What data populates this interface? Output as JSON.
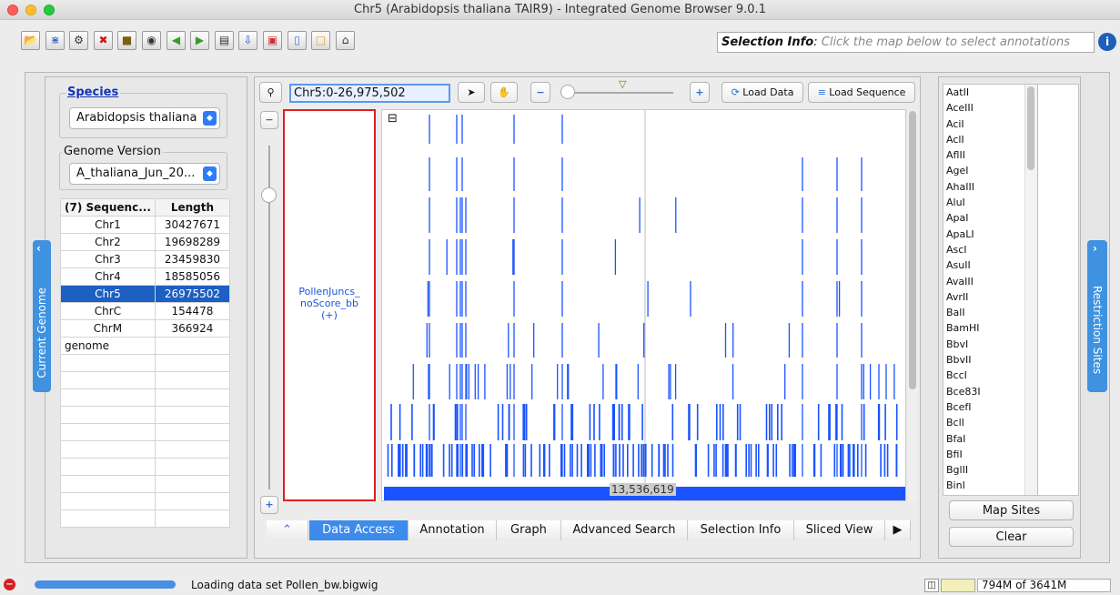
{
  "window": {
    "title": "Chr5  (Arabidopsis thaliana TAIR9) - Integrated Genome Browser 9.0.1"
  },
  "toolbar": {
    "icons": [
      "open-folder-icon",
      "dna-icon",
      "gear-icon",
      "stop-icon",
      "bookmark-icon",
      "camera-icon",
      "back-arrow-icon",
      "forward-arrow-icon",
      "film-icon",
      "export-image-icon",
      "window-icon",
      "document-icon",
      "comment-icon",
      "home-icon"
    ],
    "selection_label": "Selection Info",
    "selection_hint": "Click the map below to select annotations",
    "info_label": "i"
  },
  "left": {
    "tab_label": "Current Genome",
    "species_label": "Species",
    "species_value": "Arabidopsis thaliana",
    "genome_label": "Genome Version",
    "genome_value": "A_thaliana_Jun_20...",
    "table": {
      "headers": [
        "(7) Sequenc...",
        "Length"
      ],
      "rows": [
        [
          "Chr1",
          "30427671"
        ],
        [
          "Chr2",
          "19698289"
        ],
        [
          "Chr3",
          "23459830"
        ],
        [
          "Chr4",
          "18585056"
        ],
        [
          "Chr5",
          "26975502"
        ],
        [
          "ChrC",
          "154478"
        ],
        [
          "ChrM",
          "366924"
        ],
        [
          "genome",
          ""
        ]
      ],
      "selected_index": 4
    }
  },
  "center": {
    "location": "Chr5:0-26,975,502",
    "zoom_out_label": "−",
    "zoom_in_label": "+",
    "load_data": "Load Data",
    "load_sequence": "Load Sequence",
    "track_label_line1": "PollenJuncs_",
    "track_label_line2": "noScore_bb",
    "track_label_line3": "(+)",
    "collapse_glyph": "⊟",
    "position_readout": "13,536,619",
    "tabs": [
      "Data Access",
      "Annotation",
      "Graph",
      "Advanced Search",
      "Selection Info",
      "Sliced View"
    ],
    "active_tab": "Data Access",
    "more_tabs_glyph": "▶"
  },
  "right": {
    "tab_label": "Restriction Sites",
    "enzymes": [
      "AatII",
      "AceIII",
      "AciI",
      "AclI",
      "AflII",
      "AgeI",
      "AhaIII",
      "AluI",
      "ApaI",
      "ApaLI",
      "AscI",
      "AsuII",
      "AvaIII",
      "AvrII",
      "BalI",
      "BamHI",
      "BbvI",
      "BbvII",
      "BccI",
      "Bce83I",
      "BcefI",
      "BclI",
      "BfaI",
      "BfiI",
      "BglII",
      "BinI"
    ],
    "map_sites": "Map Sites",
    "clear": "Clear"
  },
  "status": {
    "message": "Loading data set Pollen_bw.bigwig",
    "memory": "794M of 3641M"
  },
  "colors": {
    "accent": "#1e5fc2",
    "track": "#1a53ff",
    "highlight": "#e02020"
  }
}
